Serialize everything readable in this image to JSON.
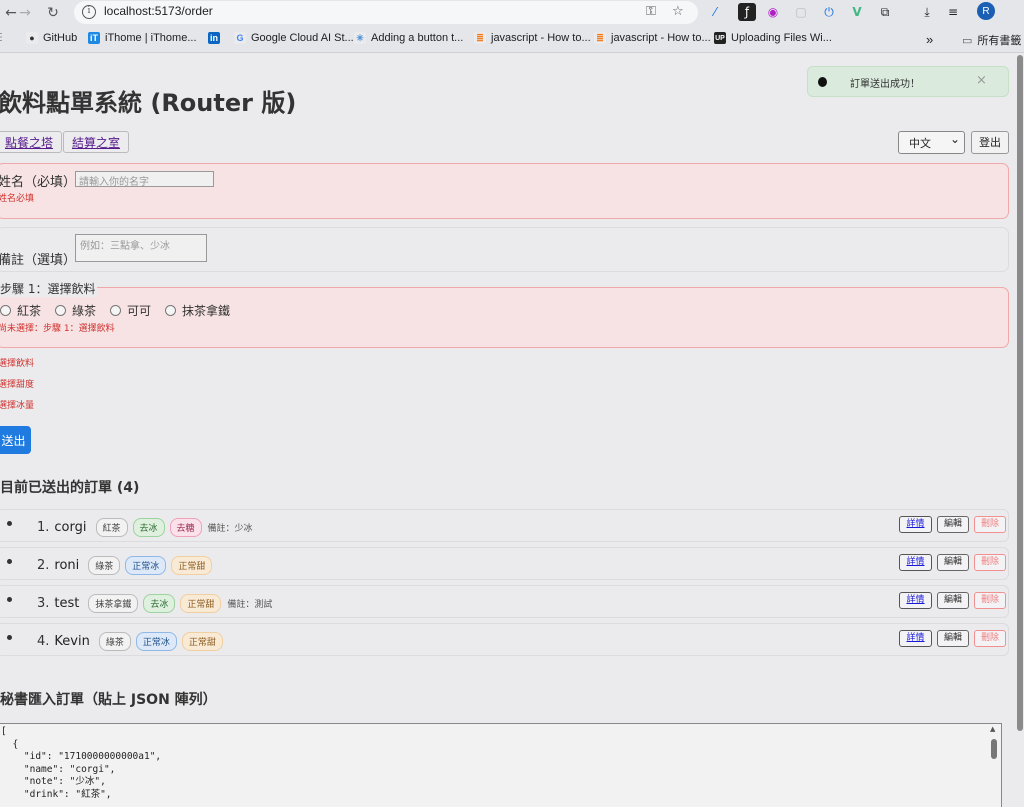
{
  "browser": {
    "url": "localhost:5173/order",
    "back": "←",
    "forward": "→",
    "reload": "↻",
    "info": "i",
    "key_icon": "⚿",
    "star_icon": "☆",
    "ext_icons": [
      "⁄",
      "ƒ",
      "◉",
      "▢",
      "⏻",
      "V",
      "⧉",
      "⤓",
      "≡",
      "♪"
    ],
    "avatar": "R",
    "more_bookmarks": "»",
    "bookmarks": [
      {
        "label": "GitHub",
        "icon": "",
        "color": "#333333"
      },
      {
        "label": "iThome | iThome...",
        "icon": "iT",
        "color": "#1e88e5"
      },
      {
        "label": "",
        "icon": "in",
        "color": "#0a66c2"
      },
      {
        "label": "Google Cloud AI St...",
        "icon": "G",
        "color": "#4285f4"
      },
      {
        "label": "Adding a button t...",
        "icon": "✳",
        "color": "#4a90d9"
      },
      {
        "label": "javascript - How to...",
        "icon": "≣",
        "color": "#f48024"
      },
      {
        "label": "javascript - How to...",
        "icon": "≣",
        "color": "#f48024"
      },
      {
        "label": "Uploading Files Wi...",
        "icon": "UP",
        "color": "#222222"
      }
    ],
    "all_bookmarks": "所有書籤"
  },
  "page": {
    "title": "飲料點單系統 (Router 版)",
    "nav_order": "點餐之塔",
    "nav_checkout": "結算之室",
    "language": "中文",
    "logout": "登出",
    "name_label": "姓名（必填）",
    "name_placeholder": "請輸入你的名字",
    "name_error": "姓名必填",
    "note_label": "備註（選填）",
    "note_placeholder": "例如：三點拿、少冰",
    "step1_legend": "步驟 1：選擇飲料",
    "drinks": [
      "紅茶",
      "綠茶",
      "可可",
      "抹茶拿鐵"
    ],
    "step1_error": "尚未選擇：步驟 1：選擇飲料",
    "errors": [
      "選擇飲料",
      "選擇甜度",
      "選擇冰量"
    ],
    "submit": "送出",
    "orders_title": "目前已送出的訂單 (4)",
    "actions": {
      "detail": "詳情",
      "edit": "編輯",
      "delete": "刪除"
    },
    "orders": [
      {
        "index": "1.",
        "name": "corgi",
        "tags": [
          {
            "text": "紅茶",
            "kind": "drink"
          },
          {
            "text": "去冰",
            "kind": "ice"
          },
          {
            "text": "去糖",
            "kind": "sugar-none"
          }
        ],
        "note": "備註：少冰"
      },
      {
        "index": "2.",
        "name": "roni",
        "tags": [
          {
            "text": "綠茶",
            "kind": "drink"
          },
          {
            "text": "正常冰",
            "kind": "ice-normal"
          },
          {
            "text": "正常甜",
            "kind": "sugar"
          }
        ],
        "note": ""
      },
      {
        "index": "3.",
        "name": "test",
        "tags": [
          {
            "text": "抹茶拿鐵",
            "kind": "drink"
          },
          {
            "text": "去冰",
            "kind": "ice"
          },
          {
            "text": "正常甜",
            "kind": "sugar"
          }
        ],
        "note": "備註：測試"
      },
      {
        "index": "4.",
        "name": "Kevin",
        "tags": [
          {
            "text": "綠茶",
            "kind": "drink"
          },
          {
            "text": "正常冰",
            "kind": "ice-normal"
          },
          {
            "text": "正常甜",
            "kind": "sugar"
          }
        ],
        "note": ""
      }
    ],
    "import_title": "秘書匯入訂單（貼上 JSON 陣列）",
    "import_json": "[\n  {\n    \"id\": \"1710000000000a1\",\n    \"name\": \"corgi\",\n    \"note\": \"少冰\",\n    \"drink\": \"紅茶\",",
    "toast_message": "訂單送出成功！",
    "toast_close": "×"
  },
  "colors": {
    "primary": "#1f7be0",
    "error": "#d0312d",
    "toast_bg": "#daebdd"
  }
}
